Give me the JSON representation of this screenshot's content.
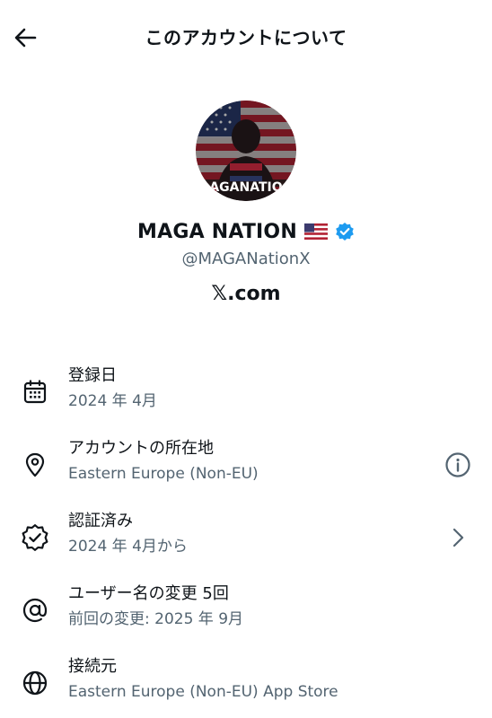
{
  "header": {
    "title": "このアカウントについて",
    "back_icon": "arrow-left-icon"
  },
  "profile": {
    "avatar_text": "AGANATIO",
    "display_name": "MAGA NATION",
    "flag_icon": "us-flag-icon",
    "verified_icon": "verified-badge-icon",
    "verified_color": "#1d9bf0",
    "handle": "@MAGANationX",
    "site": "𝕏.com"
  },
  "rows": [
    {
      "icon": "calendar-icon",
      "title": "登録日",
      "subtitle": "2024 年 4月"
    },
    {
      "icon": "location-pin-icon",
      "title": "アカウントの所在地",
      "subtitle": "Eastern Europe (Non-EU)",
      "action_icon": "info-icon"
    },
    {
      "icon": "verified-outline-icon",
      "title": "認証済み",
      "subtitle": "2024 年 4月から",
      "action_icon": "chevron-right-icon"
    },
    {
      "icon": "at-sign-icon",
      "title": "ユーザー名の変更 5回",
      "subtitle": "前回の変更: 2025 年 9月"
    },
    {
      "icon": "globe-icon",
      "title": "接続元",
      "subtitle": "Eastern Europe (Non-EU) App Store"
    }
  ],
  "colors": {
    "primary_text": "#0f1419",
    "secondary_text": "#536471",
    "accent": "#1d9bf0"
  }
}
